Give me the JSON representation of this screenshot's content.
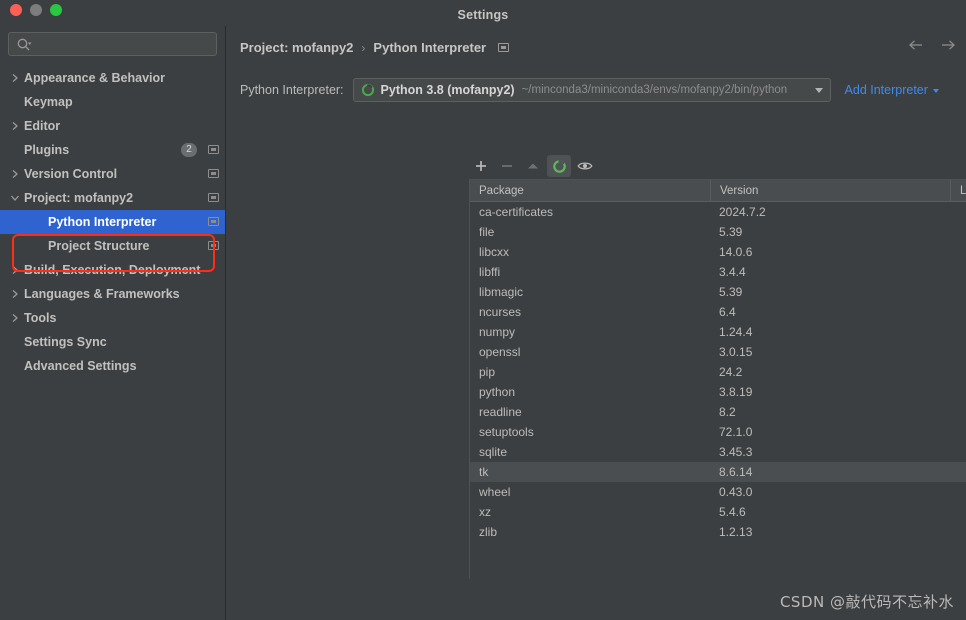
{
  "window": {
    "title": "Settings",
    "traffic_lights": [
      "close",
      "minimize",
      "zoom"
    ]
  },
  "sidebar": {
    "search": {
      "value": "",
      "placeholder": ""
    },
    "items": [
      {
        "label": "Appearance & Behavior",
        "arrow": "collapsed",
        "indent": false,
        "selected": false,
        "badge": null,
        "scope_icon": false
      },
      {
        "label": "Keymap",
        "arrow": "none",
        "indent": false,
        "selected": false,
        "badge": null,
        "scope_icon": false
      },
      {
        "label": "Editor",
        "arrow": "collapsed",
        "indent": false,
        "selected": false,
        "badge": null,
        "scope_icon": false
      },
      {
        "label": "Plugins",
        "arrow": "none",
        "indent": false,
        "selected": false,
        "badge": "2",
        "scope_icon": true
      },
      {
        "label": "Version Control",
        "arrow": "collapsed",
        "indent": false,
        "selected": false,
        "badge": null,
        "scope_icon": true
      },
      {
        "label": "Project: mofanpy2",
        "arrow": "expanded",
        "indent": false,
        "selected": false,
        "badge": null,
        "scope_icon": true
      },
      {
        "label": "Python Interpreter",
        "arrow": "none",
        "indent": true,
        "selected": true,
        "badge": null,
        "scope_icon": true
      },
      {
        "label": "Project Structure",
        "arrow": "none",
        "indent": true,
        "selected": false,
        "badge": null,
        "scope_icon": true
      },
      {
        "label": "Build, Execution, Deployment",
        "arrow": "collapsed",
        "indent": false,
        "selected": false,
        "badge": null,
        "scope_icon": false
      },
      {
        "label": "Languages & Frameworks",
        "arrow": "collapsed",
        "indent": false,
        "selected": false,
        "badge": null,
        "scope_icon": false
      },
      {
        "label": "Tools",
        "arrow": "collapsed",
        "indent": false,
        "selected": false,
        "badge": null,
        "scope_icon": false
      },
      {
        "label": "Settings Sync",
        "arrow": "none",
        "indent": false,
        "selected": false,
        "badge": null,
        "scope_icon": false
      },
      {
        "label": "Advanced Settings",
        "arrow": "none",
        "indent": false,
        "selected": false,
        "badge": null,
        "scope_icon": false
      }
    ]
  },
  "main": {
    "breadcrumb": {
      "project": "Project: mofanpy2",
      "separator": "›",
      "page": "Python Interpreter"
    },
    "nav": {
      "back": "back-arrow",
      "forward": "forward-arrow"
    },
    "interpreter": {
      "label": "Python Interpreter:",
      "selected_name": "Python 3.8 (mofanpy2)",
      "selected_path": "~/minconda3/miniconda3/envs/mofanpy2/bin/python",
      "add_label": "Add Interpreter"
    },
    "toolbar": [
      {
        "name": "add-package-button",
        "glyph": "plus",
        "enabled": true,
        "pressed": false
      },
      {
        "name": "remove-package-button",
        "glyph": "minus",
        "enabled": false,
        "pressed": false
      },
      {
        "name": "upgrade-package-button",
        "glyph": "triangle-up",
        "enabled": false,
        "pressed": false
      },
      {
        "name": "conda-toggle-button",
        "glyph": "conda-circle",
        "enabled": true,
        "pressed": true
      },
      {
        "name": "show-early-releases-button",
        "glyph": "eye",
        "enabled": true,
        "pressed": false
      }
    ],
    "table": {
      "columns": [
        "Package",
        "Version",
        "Latest version"
      ],
      "rows": [
        {
          "package": "ca-certificates",
          "version": "2024.7.2",
          "latest": "",
          "hover": false
        },
        {
          "package": "file",
          "version": "5.39",
          "latest": "",
          "hover": false
        },
        {
          "package": "libcxx",
          "version": "14.0.6",
          "latest": "",
          "hover": false
        },
        {
          "package": "libffi",
          "version": "3.4.4",
          "latest": "",
          "hover": false
        },
        {
          "package": "libmagic",
          "version": "5.39",
          "latest": "",
          "hover": false
        },
        {
          "package": "ncurses",
          "version": "6.4",
          "latest": "",
          "hover": false
        },
        {
          "package": "numpy",
          "version": "1.24.4",
          "latest": "",
          "hover": false
        },
        {
          "package": "openssl",
          "version": "3.0.15",
          "latest": "",
          "hover": false
        },
        {
          "package": "pip",
          "version": "24.2",
          "latest": "",
          "hover": false
        },
        {
          "package": "python",
          "version": "3.8.19",
          "latest": "",
          "hover": false
        },
        {
          "package": "readline",
          "version": "8.2",
          "latest": "",
          "hover": false
        },
        {
          "package": "setuptools",
          "version": "72.1.0",
          "latest": "",
          "hover": false
        },
        {
          "package": "sqlite",
          "version": "3.45.3",
          "latest": "",
          "hover": false
        },
        {
          "package": "tk",
          "version": "8.6.14",
          "latest": "",
          "hover": true
        },
        {
          "package": "wheel",
          "version": "0.43.0",
          "latest": "",
          "hover": false
        },
        {
          "package": "xz",
          "version": "5.4.6",
          "latest": "",
          "hover": false
        },
        {
          "package": "zlib",
          "version": "1.2.13",
          "latest": "",
          "hover": false
        }
      ]
    }
  },
  "watermark": "CSDN @敲代码不忘补水",
  "colors": {
    "background": "#3c3f41",
    "selection_blue": "#2f63cf",
    "link_blue": "#3d8bf0",
    "annotation_red": "#ff2d17",
    "conda_green": "#4ca64c",
    "header_row": "#4a4d4f",
    "hover_row": "#4a4e50"
  }
}
